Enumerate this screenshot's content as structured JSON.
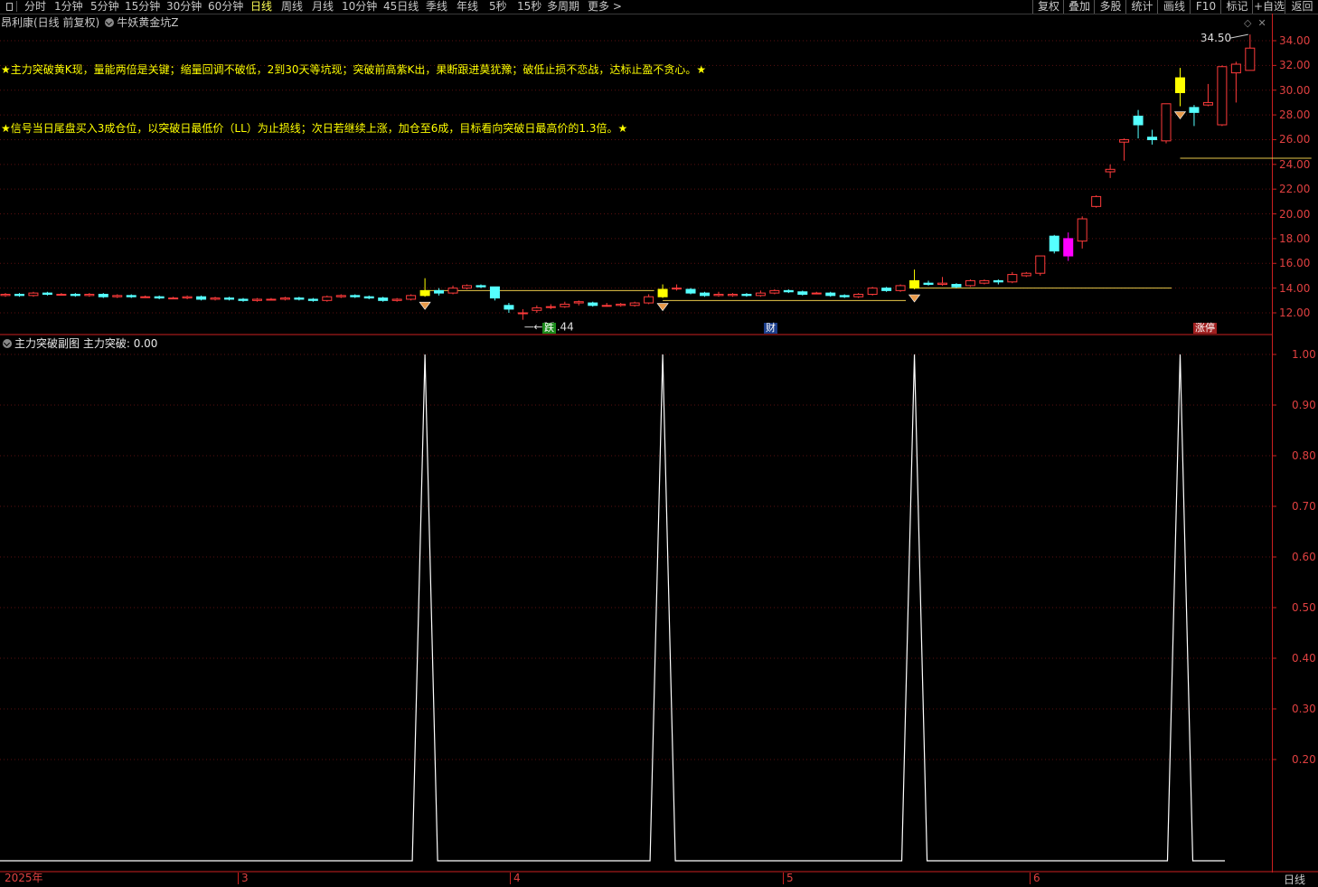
{
  "toolbar": {
    "left_items": [
      "分时",
      "1分钟",
      "5分钟",
      "15分钟",
      "30分钟",
      "60分钟",
      "日线",
      "周线",
      "月线",
      "10分钟",
      "45日线",
      "季线",
      "年线",
      "5秒",
      "15秒",
      "多周期",
      "更多 >"
    ],
    "active": "日线",
    "right_items": [
      "复权",
      "叠加",
      "多股",
      "统计",
      "画线",
      "F10",
      "标记",
      "+自选",
      "返回"
    ]
  },
  "chart_header": {
    "stock_name": "昂利康(日线 前复权)",
    "indicator_name": "牛妖黄金坑Z"
  },
  "notes": [
    "★主力突破黄K现，量能两倍是关键；缩量回调不破低，2到30天等坑现；突破前高紫K出，果断跟进莫犹豫；破低止损不恋战，达标止盈不贪心。★",
    "★信号当日尾盘买入3成仓位，以突破日最低价（LL）为止损线；次日若继续上涨，加仓至6成，目标看向突破日最高价的1.3倍。★"
  ],
  "price_axis": [
    "34.00",
    "32.00",
    "30.00",
    "28.00",
    "26.00",
    "24.00",
    "22.00",
    "20.00",
    "18.00",
    "16.00",
    "14.00",
    "12.00"
  ],
  "sub_axis": [
    "1.00",
    "0.90",
    "0.80",
    "0.70",
    "0.60",
    "0.50",
    "0.40",
    "0.30",
    "0.20"
  ],
  "price_labels": {
    "high": "34.50",
    "low": "11.44"
  },
  "event_tags": [
    {
      "text": "跌",
      "color": "#1a8a1a"
    },
    {
      "text": "财",
      "color": "#1a3d8a"
    },
    {
      "text": "涨停",
      "color": "#a02020"
    }
  ],
  "sub_chart": {
    "title": "主力突破副图",
    "series_label": "主力突破: 0.00"
  },
  "x_axis": [
    "2025年",
    "3",
    "4",
    "5",
    "6"
  ],
  "period_label": "日线",
  "corner_icons": [
    "diamond-icon",
    "close-icon"
  ],
  "colors": {
    "up": "#ff3b3b",
    "down": "#55ffff",
    "signal": "#ffff00",
    "limit_up": "#ff00ff",
    "axis": "#cc1f1f"
  },
  "chart_data": [
    {
      "type": "candlestick",
      "ylim": [
        11.0,
        35.0
      ],
      "candles": [
        {
          "o": 13.4,
          "c": 13.5,
          "h": 13.6,
          "l": 13.3
        },
        {
          "o": 13.5,
          "c": 13.4,
          "h": 13.6,
          "l": 13.3
        },
        {
          "o": 13.4,
          "c": 13.6,
          "h": 13.7,
          "l": 13.3
        },
        {
          "o": 13.6,
          "c": 13.5,
          "h": 13.7,
          "l": 13.4
        },
        {
          "o": 13.5,
          "c": 13.5,
          "h": 13.6,
          "l": 13.4
        },
        {
          "o": 13.5,
          "c": 13.4,
          "h": 13.6,
          "l": 13.3
        },
        {
          "o": 13.4,
          "c": 13.5,
          "h": 13.6,
          "l": 13.3
        },
        {
          "o": 13.5,
          "c": 13.3,
          "h": 13.6,
          "l": 13.2
        },
        {
          "o": 13.3,
          "c": 13.4,
          "h": 13.5,
          "l": 13.2
        },
        {
          "o": 13.4,
          "c": 13.3,
          "h": 13.5,
          "l": 13.2
        },
        {
          "o": 13.3,
          "c": 13.3,
          "h": 13.4,
          "l": 13.2
        },
        {
          "o": 13.3,
          "c": 13.2,
          "h": 13.4,
          "l": 13.1
        },
        {
          "o": 13.2,
          "c": 13.2,
          "h": 13.3,
          "l": 13.1
        },
        {
          "o": 13.2,
          "c": 13.3,
          "h": 13.4,
          "l": 13.1
        },
        {
          "o": 13.3,
          "c": 13.1,
          "h": 13.4,
          "l": 13.0
        },
        {
          "o": 13.1,
          "c": 13.2,
          "h": 13.3,
          "l": 13.0
        },
        {
          "o": 13.2,
          "c": 13.1,
          "h": 13.3,
          "l": 13.0
        },
        {
          "o": 13.1,
          "c": 13.0,
          "h": 13.2,
          "l": 12.9
        },
        {
          "o": 13.0,
          "c": 13.1,
          "h": 13.2,
          "l": 12.9
        },
        {
          "o": 13.1,
          "c": 13.1,
          "h": 13.2,
          "l": 13.0
        },
        {
          "o": 13.1,
          "c": 13.2,
          "h": 13.3,
          "l": 13.0
        },
        {
          "o": 13.2,
          "c": 13.1,
          "h": 13.3,
          "l": 13.0
        },
        {
          "o": 13.1,
          "c": 13.0,
          "h": 13.2,
          "l": 12.9
        },
        {
          "o": 13.0,
          "c": 13.3,
          "h": 13.4,
          "l": 12.9
        },
        {
          "o": 13.3,
          "c": 13.4,
          "h": 13.5,
          "l": 13.2
        },
        {
          "o": 13.4,
          "c": 13.3,
          "h": 13.5,
          "l": 13.2
        },
        {
          "o": 13.3,
          "c": 13.2,
          "h": 13.4,
          "l": 13.1
        },
        {
          "o": 13.2,
          "c": 13.0,
          "h": 13.3,
          "l": 12.9
        },
        {
          "o": 13.0,
          "c": 13.1,
          "h": 13.2,
          "l": 12.9
        },
        {
          "o": 13.1,
          "c": 13.4,
          "h": 13.5,
          "l": 13.0
        },
        {
          "o": 13.4,
          "c": 13.8,
          "h": 14.8,
          "l": 13.3
        },
        {
          "o": 13.8,
          "c": 13.6,
          "h": 14.0,
          "l": 13.4
        },
        {
          "o": 13.6,
          "c": 14.0,
          "h": 14.2,
          "l": 13.5
        },
        {
          "o": 14.0,
          "c": 14.2,
          "h": 14.3,
          "l": 13.9
        },
        {
          "o": 14.2,
          "c": 14.1,
          "h": 14.3,
          "l": 14.0
        },
        {
          "o": 14.1,
          "c": 13.2,
          "h": 14.1,
          "l": 13.0
        },
        {
          "o": 12.6,
          "c": 12.3,
          "h": 12.8,
          "l": 12.0
        },
        {
          "o": 12.0,
          "c": 12.0,
          "h": 12.3,
          "l": 11.44
        },
        {
          "o": 12.2,
          "c": 12.4,
          "h": 12.6,
          "l": 12.0
        },
        {
          "o": 12.5,
          "c": 12.5,
          "h": 12.7,
          "l": 12.3
        },
        {
          "o": 12.5,
          "c": 12.7,
          "h": 12.9,
          "l": 12.4
        },
        {
          "o": 12.8,
          "c": 12.9,
          "h": 13.0,
          "l": 12.6
        },
        {
          "o": 12.8,
          "c": 12.6,
          "h": 12.9,
          "l": 12.5
        },
        {
          "o": 12.6,
          "c": 12.6,
          "h": 12.8,
          "l": 12.5
        },
        {
          "o": 12.6,
          "c": 12.7,
          "h": 12.8,
          "l": 12.5
        },
        {
          "o": 12.6,
          "c": 12.8,
          "h": 12.9,
          "l": 12.5
        },
        {
          "o": 12.8,
          "c": 13.3,
          "h": 13.5,
          "l": 12.7
        },
        {
          "o": 13.3,
          "c": 13.9,
          "h": 14.3,
          "l": 13.2
        },
        {
          "o": 14.0,
          "c": 14.0,
          "h": 14.3,
          "l": 13.8
        },
        {
          "o": 13.9,
          "c": 13.6,
          "h": 14.0,
          "l": 13.5
        },
        {
          "o": 13.6,
          "c": 13.4,
          "h": 13.7,
          "l": 13.3
        },
        {
          "o": 13.4,
          "c": 13.5,
          "h": 13.7,
          "l": 13.3
        },
        {
          "o": 13.4,
          "c": 13.5,
          "h": 13.6,
          "l": 13.3
        },
        {
          "o": 13.5,
          "c": 13.4,
          "h": 13.6,
          "l": 13.3
        },
        {
          "o": 13.4,
          "c": 13.6,
          "h": 13.8,
          "l": 13.3
        },
        {
          "o": 13.6,
          "c": 13.8,
          "h": 13.9,
          "l": 13.5
        },
        {
          "o": 13.8,
          "c": 13.7,
          "h": 13.9,
          "l": 13.6
        },
        {
          "o": 13.7,
          "c": 13.5,
          "h": 13.8,
          "l": 13.4
        },
        {
          "o": 13.6,
          "c": 13.6,
          "h": 13.7,
          "l": 13.5
        },
        {
          "o": 13.6,
          "c": 13.4,
          "h": 13.7,
          "l": 13.3
        },
        {
          "o": 13.4,
          "c": 13.3,
          "h": 13.5,
          "l": 13.2
        },
        {
          "o": 13.3,
          "c": 13.5,
          "h": 13.6,
          "l": 13.2
        },
        {
          "o": 13.5,
          "c": 14.0,
          "h": 14.1,
          "l": 13.4
        },
        {
          "o": 14.0,
          "c": 13.8,
          "h": 14.1,
          "l": 13.7
        },
        {
          "o": 13.8,
          "c": 14.2,
          "h": 14.3,
          "l": 13.7
        },
        {
          "o": 14.0,
          "c": 14.6,
          "h": 15.5,
          "l": 13.9
        },
        {
          "o": 14.4,
          "c": 14.3,
          "h": 14.6,
          "l": 14.2
        },
        {
          "o": 14.3,
          "c": 14.4,
          "h": 14.9,
          "l": 14.2
        },
        {
          "o": 14.3,
          "c": 14.1,
          "h": 14.4,
          "l": 14.0
        },
        {
          "o": 14.2,
          "c": 14.6,
          "h": 14.7,
          "l": 14.1
        },
        {
          "o": 14.4,
          "c": 14.6,
          "h": 14.7,
          "l": 14.3
        },
        {
          "o": 14.6,
          "c": 14.5,
          "h": 14.7,
          "l": 14.3
        },
        {
          "o": 14.5,
          "c": 15.1,
          "h": 15.3,
          "l": 14.4
        },
        {
          "o": 15.0,
          "c": 15.2,
          "h": 15.3,
          "l": 14.9
        },
        {
          "o": 15.2,
          "c": 16.6,
          "h": 16.6,
          "l": 15.0
        },
        {
          "o": 18.2,
          "c": 17.0,
          "h": 18.3,
          "l": 16.8
        },
        {
          "o": 16.6,
          "c": 18.0,
          "h": 18.5,
          "l": 16.2
        },
        {
          "o": 17.8,
          "c": 19.6,
          "h": 19.8,
          "l": 17.2
        },
        {
          "o": 20.6,
          "c": 21.4,
          "h": 21.5,
          "l": 20.5
        },
        {
          "o": 23.4,
          "c": 23.6,
          "h": 24.0,
          "l": 22.9
        },
        {
          "o": 25.8,
          "c": 26.0,
          "h": 26.1,
          "l": 24.3
        },
        {
          "o": 27.9,
          "c": 27.2,
          "h": 28.4,
          "l": 26.1
        },
        {
          "o": 26.2,
          "c": 26.0,
          "h": 26.8,
          "l": 25.6
        },
        {
          "o": 25.9,
          "c": 28.9,
          "h": 28.9,
          "l": 25.7
        },
        {
          "o": 31.0,
          "c": 29.8,
          "h": 31.8,
          "l": 28.7
        },
        {
          "o": 28.6,
          "c": 28.2,
          "h": 28.8,
          "l": 27.1
        },
        {
          "o": 28.8,
          "c": 29.0,
          "h": 30.5,
          "l": 28.7
        },
        {
          "o": 27.2,
          "c": 31.9,
          "h": 32.0,
          "l": 27.1
        },
        {
          "o": 31.4,
          "c": 32.1,
          "h": 32.3,
          "l": 29.0
        },
        {
          "o": 31.6,
          "c": 33.4,
          "h": 34.5,
          "l": 31.6
        }
      ],
      "signal_candles": [
        30,
        47,
        65,
        84
      ],
      "limit_up_candle": 76,
      "support_lines": [
        {
          "price": 13.8,
          "from": 30,
          "to": 46
        },
        {
          "price": 13.0,
          "from": 47,
          "to": 64
        },
        {
          "price": 14.0,
          "from": 65,
          "to": 83
        },
        {
          "price": 24.5,
          "from": 84,
          "to": 93
        }
      ]
    },
    {
      "type": "line",
      "series": [
        {
          "name": "主力突破",
          "spikes_at": [
            30,
            47,
            65,
            84
          ],
          "value": 1.0,
          "baseline": 0.0
        }
      ],
      "ylim": [
        0.0,
        1.0
      ]
    }
  ]
}
